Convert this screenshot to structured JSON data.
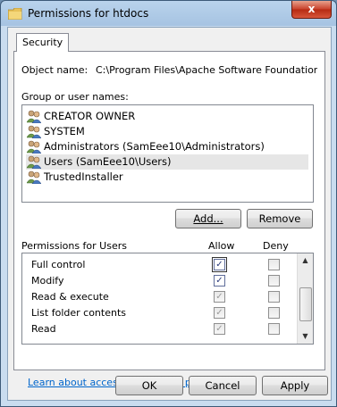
{
  "window": {
    "title": "Permissions for htdocs",
    "close_glyph": "x"
  },
  "tabs": [
    {
      "label": "Security"
    }
  ],
  "object": {
    "label": "Object name:",
    "value": "C:\\Program Files\\Apache Software Foundation\\Apache"
  },
  "groups": {
    "label": "Group or user names:",
    "items": [
      {
        "label": "CREATOR OWNER",
        "selected": false
      },
      {
        "label": "SYSTEM",
        "selected": false
      },
      {
        "label": "Administrators (SamEee10\\Administrators)",
        "selected": false
      },
      {
        "label": "Users (SamEee10\\Users)",
        "selected": true
      },
      {
        "label": "TrustedInstaller",
        "selected": false
      }
    ]
  },
  "buttons": {
    "add": "Add...",
    "remove": "Remove",
    "ok": "OK",
    "cancel": "Cancel",
    "apply": "Apply"
  },
  "permissions": {
    "label": "Permissions for Users",
    "allow_header": "Allow",
    "deny_header": "Deny",
    "rows": [
      {
        "name": "Full control",
        "allow": true,
        "deny": false
      },
      {
        "name": "Modify",
        "allow": true,
        "deny": false
      },
      {
        "name": "Read & execute",
        "allow": true,
        "deny": false
      },
      {
        "name": "List folder contents",
        "allow": true,
        "deny": false
      },
      {
        "name": "Read",
        "allow": true,
        "deny": false
      }
    ]
  },
  "link": {
    "text": "Learn about access control and permissions"
  },
  "icons": {
    "folder": "folder-icon",
    "user": "users-group-icon",
    "check": "✓"
  }
}
